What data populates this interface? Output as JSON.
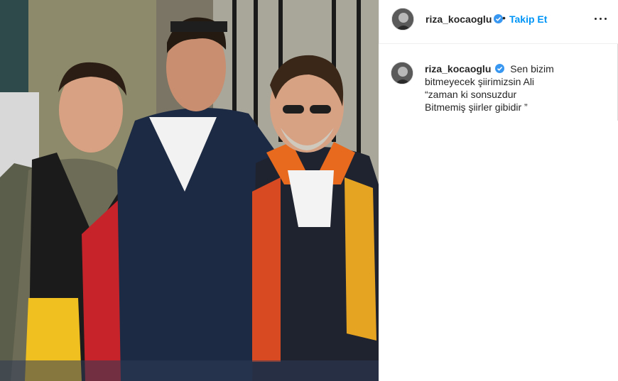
{
  "post": {
    "image_alt": "Photo of three men wearing red and yellow football scarves"
  },
  "header": {
    "username": "riza_kocaoglu",
    "dot": "•",
    "follow_label": "Takip Et",
    "verified_icon": "verified-badge-icon",
    "more_icon": "more-options-icon"
  },
  "caption": {
    "username": "riza_kocaoglu",
    "lines": [
      "Sen bizim",
      "bitmeyecek şiirimizsin Ali",
      "“zaman ki sonsuzdur",
      "Bitmemiş şiirler gibidir ”"
    ]
  },
  "colors": {
    "accent": "#0095f6",
    "verified": "#3897f0",
    "text": "#262626",
    "border": "#efefef"
  }
}
